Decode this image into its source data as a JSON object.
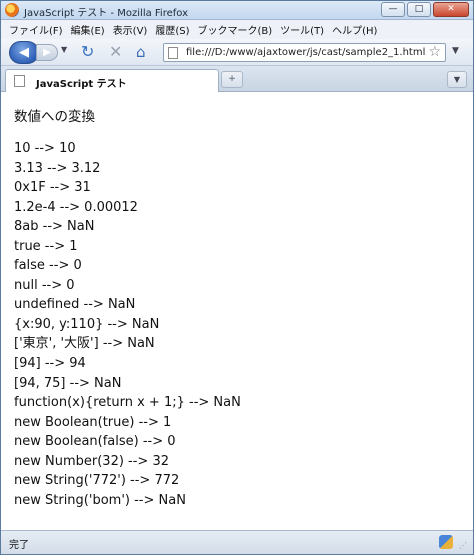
{
  "window": {
    "title": "JavaScript テスト - Mozilla Firefox",
    "buttons": {
      "minimize": "—",
      "maximize": "□",
      "close": "✕"
    }
  },
  "menubar": {
    "items": [
      "ファイル(F)",
      "編集(E)",
      "表示(V)",
      "履歴(S)",
      "ブックマーク(B)",
      "ツール(T)",
      "ヘルプ(H)"
    ]
  },
  "toolbar": {
    "url": "file:///D:/www/ajaxtower/js/cast/sample2_1.html",
    "icons": {
      "back": "back-arrow-icon",
      "forward": "forward-arrow-icon",
      "reload": "reload-icon",
      "stop": "stop-icon",
      "home": "home-icon",
      "bookmark": "star-icon"
    }
  },
  "tabs": [
    {
      "label": "JavaScript テスト"
    }
  ],
  "content": {
    "title": "数値への変換",
    "results": [
      "10 --> 10",
      "3.13 --> 3.12",
      "0x1F --> 31",
      "1.2e-4 --> 0.00012",
      "8ab --> NaN",
      "true --> 1",
      "false --> 0",
      "null --> 0",
      "undefined --> NaN",
      "{x:90, y:110} --> NaN",
      "['東京', '大阪'] --> NaN",
      "[94] --> 94",
      "[94, 75] --> NaN",
      "function(x){return x + 1;} --> NaN",
      "new Boolean(true) --> 1",
      "new Boolean(false) --> 0",
      "new Number(32) --> 32",
      "new String('772') --> 772",
      "new String('bom') --> NaN"
    ]
  },
  "status": {
    "text": "完了"
  }
}
